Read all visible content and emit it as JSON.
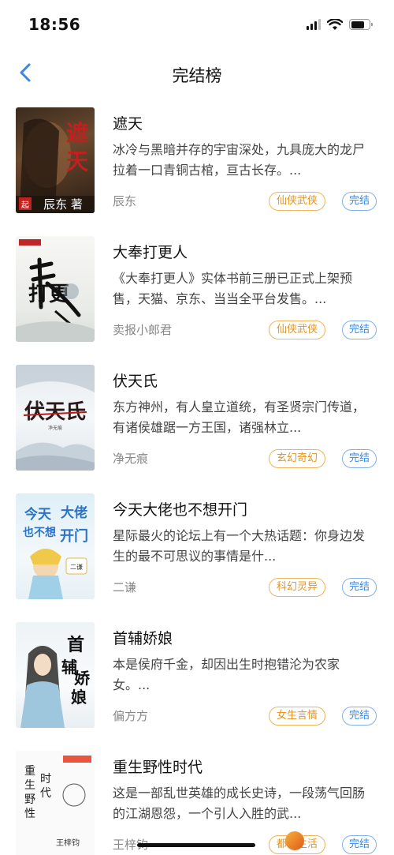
{
  "status_bar": {
    "time": "18:56",
    "battery_level": 0.75
  },
  "nav": {
    "title": "完结榜"
  },
  "books": [
    {
      "title": "遮天",
      "description": "冰冷与黑暗并存的宇宙深处，九具庞大的龙尸拉着一口青铜古棺，亘古长存。...",
      "author": "辰东",
      "genre": "仙侠武侠",
      "status": "完结",
      "cover_text": "遮天",
      "cover_author": "辰东 著"
    },
    {
      "title": "大奉打更人",
      "description": "《大奉打更人》实体书前三册已正式上架预售，天猫、京东、当当全平台发售。...",
      "author": "卖报小郎君",
      "genre": "仙侠武侠",
      "status": "完结",
      "cover_text": "打更人"
    },
    {
      "title": "伏天氏",
      "description": "东方神州，有人皇立道统，有圣贤宗门传道，有诸侯雄踞一方王国，诸强林立...",
      "author": "净无痕",
      "genre": "玄幻奇幻",
      "status": "完结",
      "cover_text": "伏天氏"
    },
    {
      "title": "今天大佬也不想开门",
      "description": "星际最火的论坛上有一个大热话题：你身边发生的最不可思议的事情是什...",
      "author": "二谦",
      "genre": "科幻灵异",
      "status": "完结",
      "cover_text": "今天大佬也不想开门"
    },
    {
      "title": "首辅娇娘",
      "description": "本是侯府千金，却因出生时抱错沦为农家女。...",
      "author": "偏方方",
      "genre": "女生言情",
      "status": "完结",
      "cover_text": "首辅娇娘"
    },
    {
      "title": "重生野性时代",
      "description": "这是一部乱世英雄的成长史诗，一段荡气回肠的江湖恩怨，一个引人入胜的武...",
      "author": "王梓钧",
      "genre": "都市生活",
      "status": "完结",
      "cover_text": "重生野性时代"
    }
  ],
  "colors": {
    "accent": "#3a86e0",
    "genre_tag": "#e39524"
  }
}
